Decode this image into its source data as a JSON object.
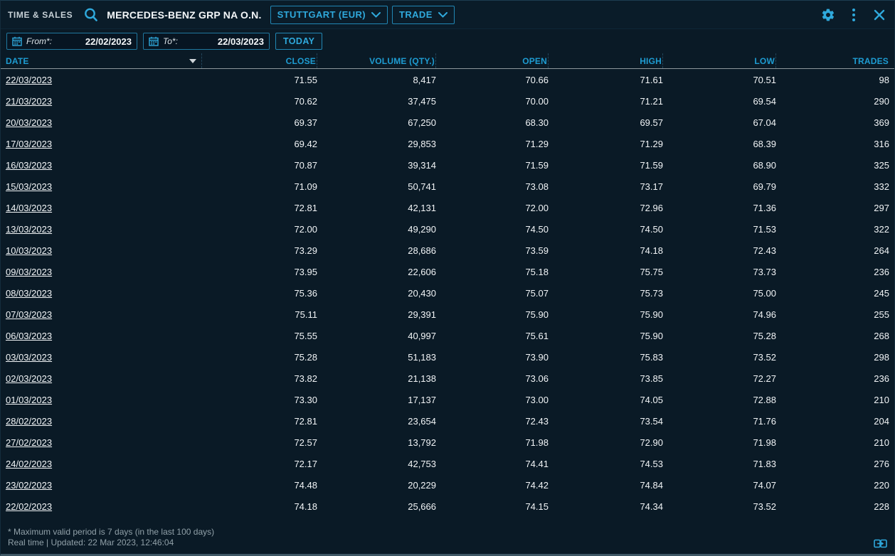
{
  "window": {
    "title": "TIME & SALES",
    "instrument": "MERCEDES-BENZ GRP NA O.N.",
    "venue_dropdown": "STUTTGART (EUR)",
    "trade_dropdown": "TRADE"
  },
  "filters": {
    "from_label": "From*:",
    "from_value": "22/02/2023",
    "to_label": "To*:",
    "to_value": "22/03/2023",
    "today_label": "TODAY"
  },
  "table": {
    "columns": [
      "DATE",
      "CLOSE",
      "VOLUME (QTY.)",
      "OPEN",
      "HIGH",
      "LOW",
      "TRADES"
    ],
    "column_keys": [
      "date",
      "close",
      "volume",
      "open",
      "high",
      "low",
      "trades"
    ],
    "sort": {
      "column": "DATE",
      "direction": "descending"
    },
    "rows": [
      [
        "22/03/2023",
        "71.55",
        "8,417",
        "70.66",
        "71.61",
        "70.51",
        "98"
      ],
      [
        "21/03/2023",
        "70.62",
        "37,475",
        "70.00",
        "71.21",
        "69.54",
        "290"
      ],
      [
        "20/03/2023",
        "69.37",
        "67,250",
        "68.30",
        "69.57",
        "67.04",
        "369"
      ],
      [
        "17/03/2023",
        "69.42",
        "29,853",
        "71.29",
        "71.29",
        "68.39",
        "316"
      ],
      [
        "16/03/2023",
        "70.87",
        "39,314",
        "71.59",
        "71.59",
        "68.90",
        "325"
      ],
      [
        "15/03/2023",
        "71.09",
        "50,741",
        "73.08",
        "73.17",
        "69.79",
        "332"
      ],
      [
        "14/03/2023",
        "72.81",
        "42,131",
        "72.00",
        "72.96",
        "71.36",
        "297"
      ],
      [
        "13/03/2023",
        "72.00",
        "49,290",
        "74.50",
        "74.50",
        "71.53",
        "322"
      ],
      [
        "10/03/2023",
        "73.29",
        "28,686",
        "73.59",
        "74.18",
        "72.43",
        "264"
      ],
      [
        "09/03/2023",
        "73.95",
        "22,606",
        "75.18",
        "75.75",
        "73.73",
        "236"
      ],
      [
        "08/03/2023",
        "75.36",
        "20,430",
        "75.07",
        "75.73",
        "75.00",
        "245"
      ],
      [
        "07/03/2023",
        "75.11",
        "29,391",
        "75.90",
        "75.90",
        "74.96",
        "255"
      ],
      [
        "06/03/2023",
        "75.55",
        "40,997",
        "75.61",
        "75.90",
        "75.28",
        "268"
      ],
      [
        "03/03/2023",
        "75.28",
        "51,183",
        "73.90",
        "75.83",
        "73.52",
        "298"
      ],
      [
        "02/03/2023",
        "73.82",
        "21,138",
        "73.06",
        "73.85",
        "72.27",
        "236"
      ],
      [
        "01/03/2023",
        "73.30",
        "17,137",
        "73.00",
        "74.05",
        "72.88",
        "210"
      ],
      [
        "28/02/2023",
        "72.81",
        "23,654",
        "72.43",
        "73.54",
        "71.76",
        "204"
      ],
      [
        "27/02/2023",
        "72.57",
        "13,792",
        "71.98",
        "72.90",
        "71.98",
        "210"
      ],
      [
        "24/02/2023",
        "72.17",
        "42,753",
        "74.41",
        "74.53",
        "71.83",
        "276"
      ],
      [
        "23/02/2023",
        "74.48",
        "20,229",
        "74.42",
        "74.84",
        "74.07",
        "220"
      ],
      [
        "22/02/2023",
        "74.18",
        "25,666",
        "74.15",
        "74.34",
        "73.52",
        "228"
      ]
    ]
  },
  "footer": {
    "note": "* Maximum valid period is 7 days (in the last 100 days)",
    "status": "Real time | Updated: 22 Mar 2023, 12:46:04"
  },
  "icons": {
    "topbar": [
      "search-icon",
      "gear-icon",
      "kebab-menu-icon",
      "close-icon"
    ],
    "filters": [
      "calendar-icon"
    ],
    "footer": [
      "link-channel-icon"
    ]
  },
  "colors": {
    "background": "#0a1a26",
    "accent_cyan": "#2fa9dc",
    "header_text": "#1e9cd2",
    "value_text": "#f2f5f7",
    "muted_text": "#90a0a8",
    "field_border": "#20789f",
    "header_rule": "#8e979c"
  }
}
